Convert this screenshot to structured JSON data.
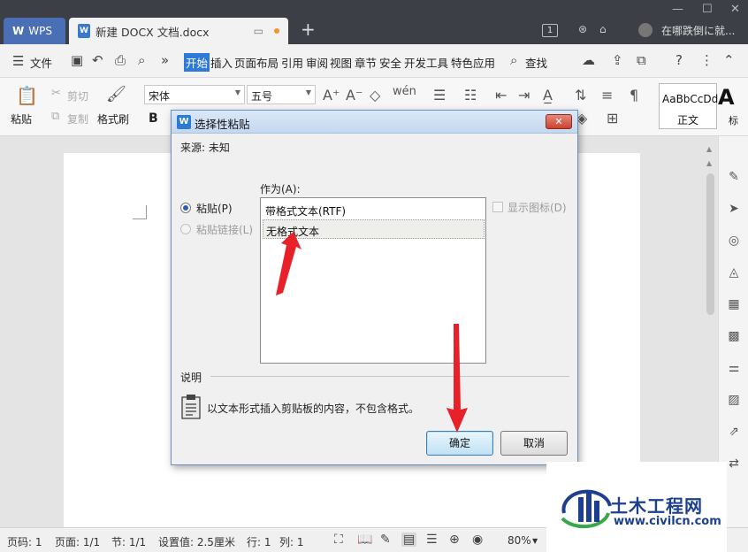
{
  "titlebar": {
    "app_tab": "WPS",
    "doc_tab": "新建 DOCX 文档.docx",
    "new_tab": "+",
    "badge": "1",
    "user_name": "在哪跌倒に就..."
  },
  "menu": {
    "file": "文件",
    "items": [
      "开始",
      "插入",
      "页面布局",
      "引用",
      "审阅",
      "视图",
      "章节",
      "安全",
      "开发工具",
      "特色应用"
    ],
    "search": "查找"
  },
  "ribbon": {
    "paste": "粘贴",
    "cut": "剪切",
    "copy": "复制",
    "format_painter": "格式刷",
    "font_name": "宋体",
    "font_size": "五号",
    "bold": "B",
    "style_sample": "AaBbCcDd",
    "style_name": "正文",
    "style_big": "A",
    "style_cut": "标"
  },
  "dialog": {
    "title": "选择性粘贴",
    "source_label": "来源: 未知",
    "as_label": "作为(A):",
    "radio_paste": "粘贴(P)",
    "radio_paste_link": "粘贴链接(L)",
    "show_icon": "显示图标(D)",
    "list_items": [
      "带格式文本(RTF)",
      "无格式文本"
    ],
    "selected_item": "无格式文本",
    "description_label": "说明",
    "description_text": "以文本形式插入剪贴板的内容，不包含格式。",
    "ok": "确定",
    "cancel": "取消"
  },
  "statusbar": {
    "page": "页码: 1",
    "pages": "页面: 1/1",
    "section": "节: 1/1",
    "settings": "设置值: 2.5厘米",
    "row": "行: 1",
    "col": "列: 1",
    "zoom": "80%"
  },
  "watermark": {
    "title": "土木工程网",
    "url": "www.civilcn.com"
  },
  "colors": {
    "accent": "#2f7ad9",
    "arrow": "#e8202a",
    "wps_tab": "#4a6fb5"
  }
}
